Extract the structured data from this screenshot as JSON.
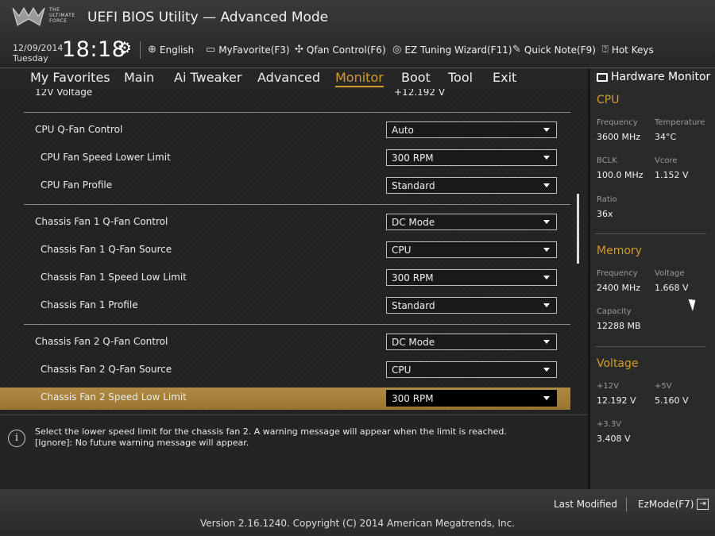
{
  "header": {
    "logo_text": "THE ULTIMATE FORCE",
    "title": "UEFI BIOS Utility — Advanced Mode",
    "date": "12/09/2014",
    "day": "Tuesday",
    "time": "18:18"
  },
  "toolbar": {
    "language": "English",
    "myfavorite": "MyFavorite(F3)",
    "qfan": "Qfan Control(F6)",
    "ez_tuning": "EZ Tuning Wizard(F11)",
    "quick_note": "Quick Note(F9)",
    "hot_keys": "Hot Keys"
  },
  "nav": {
    "tabs": [
      "My Favorites",
      "Main",
      "Ai Tweaker",
      "Advanced",
      "Monitor",
      "Boot",
      "Tool",
      "Exit"
    ],
    "active": "Monitor"
  },
  "main": {
    "partial_row": {
      "label": "12V Voltage",
      "value": "+12.192 V"
    },
    "rows": [
      {
        "label": "CPU Q-Fan Control",
        "value": "Auto"
      },
      {
        "label": "CPU Fan Speed Lower Limit",
        "value": "300 RPM"
      },
      {
        "label": "CPU Fan Profile",
        "value": "Standard"
      },
      {
        "label": "Chassis Fan 1 Q-Fan Control",
        "value": "DC Mode"
      },
      {
        "label": "Chassis Fan 1 Q-Fan Source",
        "value": "CPU"
      },
      {
        "label": "Chassis Fan 1 Speed Low Limit",
        "value": "300 RPM"
      },
      {
        "label": "Chassis Fan 1 Profile",
        "value": "Standard"
      },
      {
        "label": "Chassis Fan 2 Q-Fan Control",
        "value": "DC Mode"
      },
      {
        "label": "Chassis Fan 2 Q-Fan Source",
        "value": "CPU"
      },
      {
        "label": "Chassis Fan 2 Speed Low Limit",
        "value": "300 RPM"
      }
    ]
  },
  "info": {
    "line1": "Select the lower speed limit for the chassis fan 2. A warning message will appear when the limit is reached.",
    "line2": "[Ignore]: No future warning message will appear."
  },
  "hardware_monitor": {
    "title": "Hardware Monitor",
    "cpu": {
      "heading": "CPU",
      "frequency_label": "Frequency",
      "frequency": "3600 MHz",
      "temperature_label": "Temperature",
      "temperature": "34°C",
      "bclk_label": "BCLK",
      "bclk": "100.0 MHz",
      "vcore_label": "Vcore",
      "vcore": "1.152 V",
      "ratio_label": "Ratio",
      "ratio": "36x"
    },
    "memory": {
      "heading": "Memory",
      "frequency_label": "Frequency",
      "frequency": "2400 MHz",
      "voltage_label": "Voltage",
      "voltage": "1.668 V",
      "capacity_label": "Capacity",
      "capacity": "12288 MB"
    },
    "voltage": {
      "heading": "Voltage",
      "v12_label": "+12V",
      "v12": "12.192 V",
      "v5_label": "+5V",
      "v5": "5.160 V",
      "v33_label": "+3.3V",
      "v33": "3.408 V"
    }
  },
  "footer": {
    "last_modified": "Last Modified",
    "ezmode": "EzMode(F7)",
    "version": "Version 2.16.1240. Copyright (C) 2014 American Megatrends, Inc."
  },
  "colors": {
    "accent": "#d39b2b",
    "highlight": "#a8843d"
  }
}
